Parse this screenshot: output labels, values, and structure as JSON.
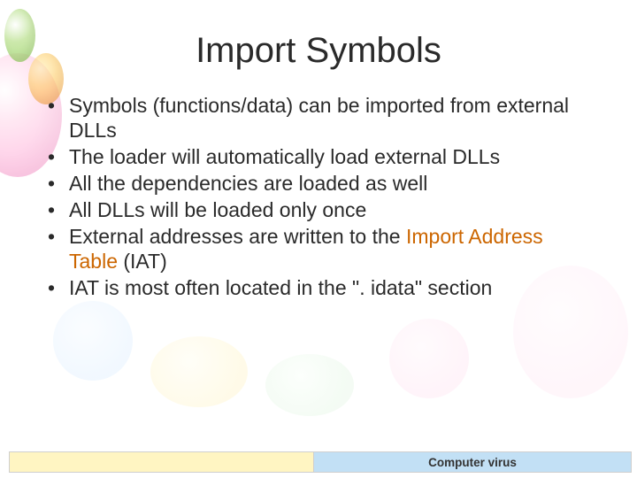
{
  "title": "Import Symbols",
  "bullets": [
    {
      "text": "Symbols (functions/data) can be imported from external DLLs"
    },
    {
      "text": "The loader will automatically load external DLLs"
    },
    {
      "text": "All the dependencies are loaded as well"
    },
    {
      "text": "All DLLs will be loaded only once"
    },
    {
      "pre": "External addresses are written to the ",
      "emph": "Import Address Table",
      "post": " (IAT)"
    },
    {
      "text": "IAT is most often located in the \". idata\" section"
    }
  ],
  "footer": {
    "left": "",
    "right": "Computer virus"
  }
}
